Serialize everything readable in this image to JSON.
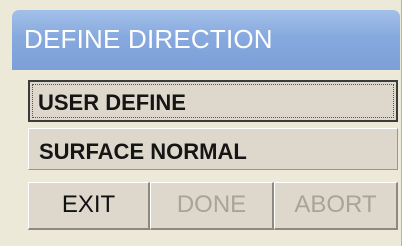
{
  "window": {
    "title": "DEFINE DIRECTION"
  },
  "menu": {
    "items": [
      {
        "label": "USER DEFINE"
      },
      {
        "label": "SURFACE NORMAL"
      }
    ]
  },
  "buttons": {
    "exit": "EXIT",
    "done": "DONE",
    "abort": "ABORT"
  },
  "colors": {
    "title_bar": "#86a9de",
    "panel_background": "#ece9d8",
    "disabled_text": "#a8a49a"
  }
}
